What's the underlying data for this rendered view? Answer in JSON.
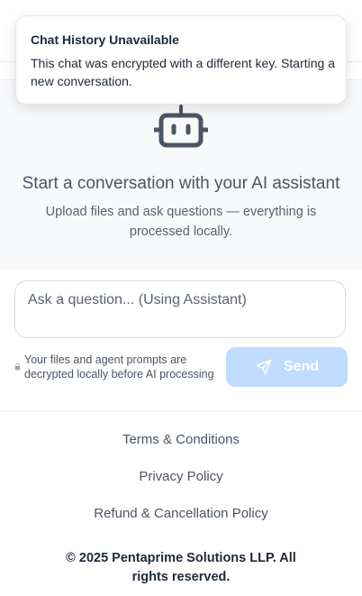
{
  "toast": {
    "title": "Chat History Unavailable",
    "message": "This chat was encrypted with a different key. Starting a new conversation."
  },
  "empty_state": {
    "icon": "robot-icon",
    "title": "Start a conversation with your AI assistant",
    "subtitle": "Upload files and ask questions — everything is processed locally."
  },
  "composer": {
    "placeholder": "Ask a question... (Using Assistant)",
    "privacy_note": "Your files and agent prompts are decrypted locally before AI processing",
    "send_label": "Send",
    "send_icon": "paper-plane-icon",
    "send_color": "#bfdbfe"
  },
  "footer": {
    "links": [
      "Terms & Conditions",
      "Privacy Policy",
      "Refund & Cancellation Policy"
    ],
    "copyright": "© 2025 Pentaprime Solutions LLP. All rights reserved."
  },
  "colors": {
    "accent_disabled": "#bfdbfe",
    "text_muted": "#4b5563",
    "chat_background": "#f8f9fb"
  }
}
